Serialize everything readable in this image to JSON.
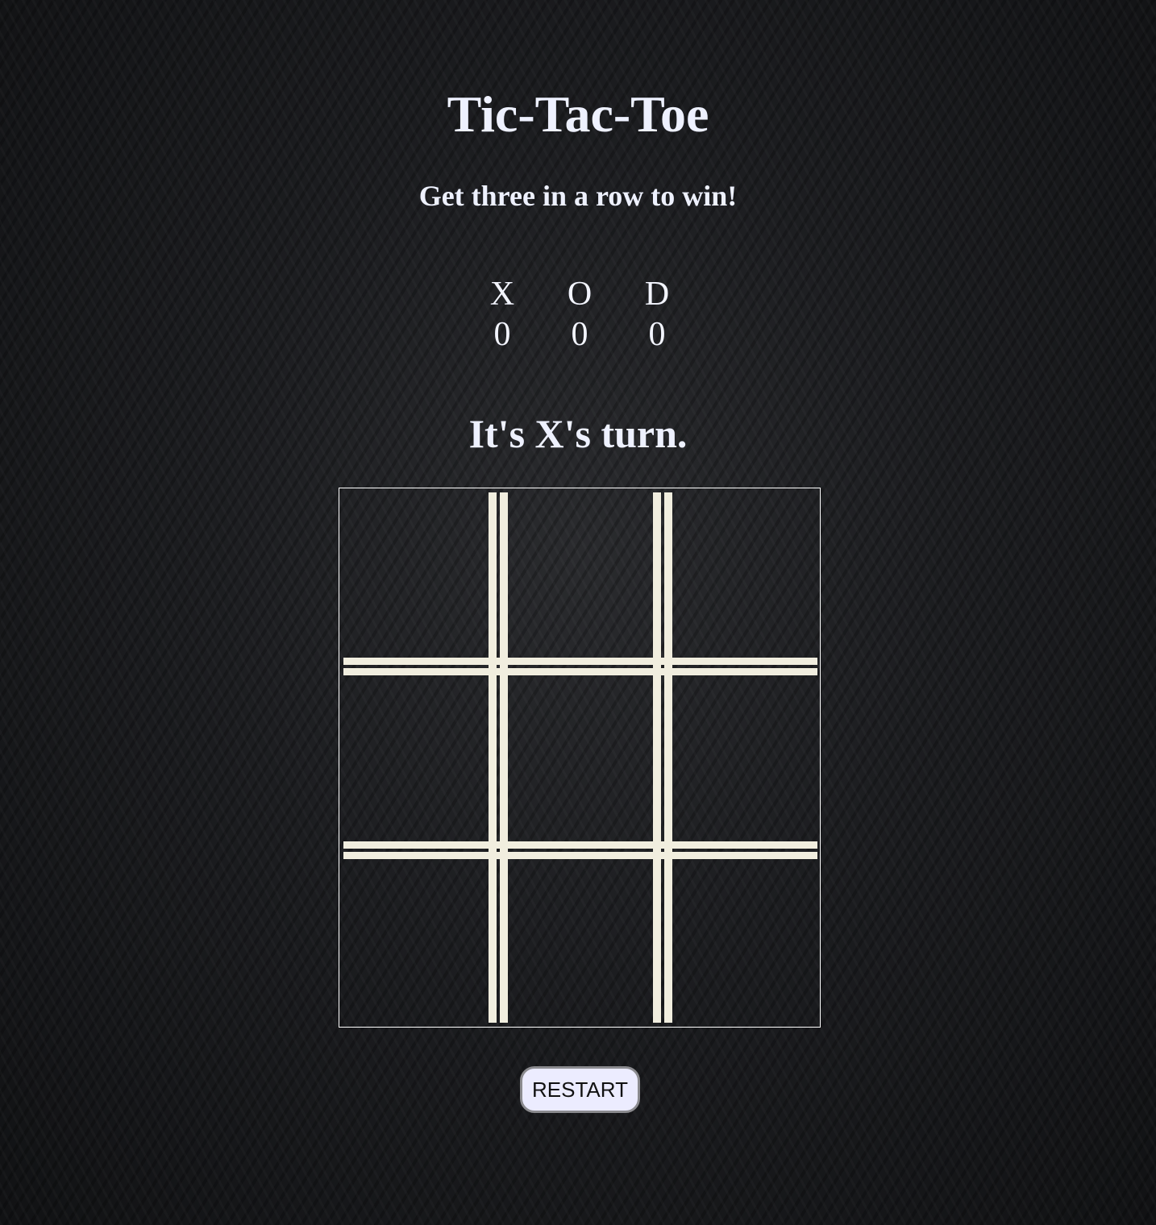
{
  "header": {
    "title": "Tic-Tac-Toe",
    "subtitle": "Get three in a row to win!"
  },
  "scoreboard": [
    {
      "label": "X",
      "value": "0"
    },
    {
      "label": "O",
      "value": "0"
    },
    {
      "label": "D",
      "value": "0"
    }
  ],
  "status": "It's X's turn.",
  "board": {
    "cells": [
      "",
      "",
      "",
      "",
      "",
      "",
      "",
      "",
      ""
    ],
    "line_color": "#f1eedf"
  },
  "controls": {
    "restart_label": "RESTART"
  },
  "colors": {
    "text": "#eef1ff",
    "button_bg": "#ececff",
    "button_border": "#8b8b8f"
  }
}
